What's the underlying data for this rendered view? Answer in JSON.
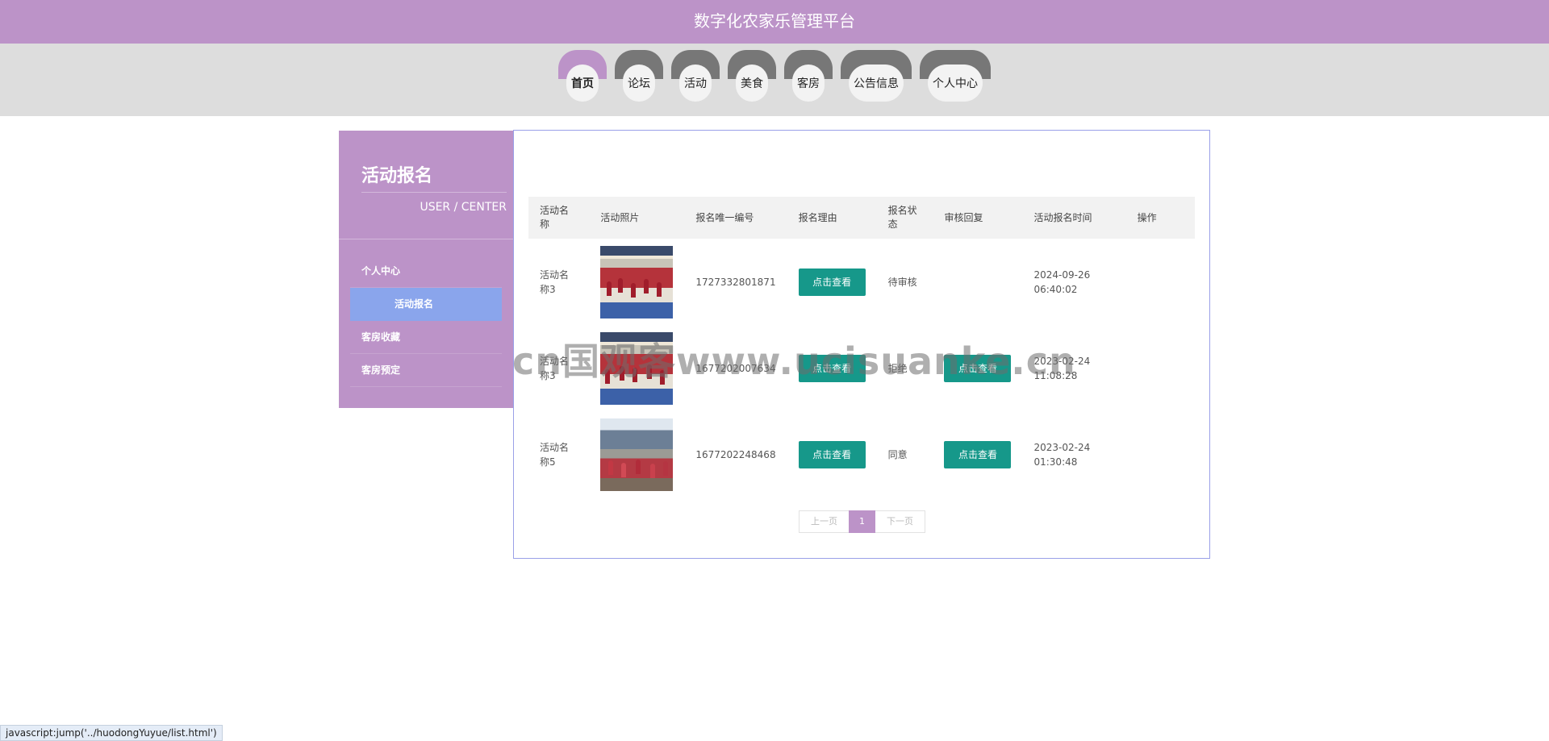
{
  "header": {
    "title": "数字化农家乐管理平台"
  },
  "nav": {
    "items": [
      {
        "label": "首页"
      },
      {
        "label": "论坛"
      },
      {
        "label": "活动"
      },
      {
        "label": "美食"
      },
      {
        "label": "客房"
      },
      {
        "label": "公告信息"
      },
      {
        "label": "个人中心"
      }
    ],
    "active": "首页"
  },
  "sidebar": {
    "title": "活动报名",
    "subtitle": "USER / CENTER",
    "menu": [
      {
        "label": "个人中心"
      },
      {
        "label": "活动报名"
      },
      {
        "label": "客房收藏"
      },
      {
        "label": "客房预定"
      }
    ],
    "active": "活动报名"
  },
  "table": {
    "headers": {
      "name": "活动名称",
      "photo": "活动照片",
      "id": "报名唯一编号",
      "reason": "报名理由",
      "status": "报名状态",
      "reply": "审核回复",
      "time": "活动报名时间",
      "op": "操作"
    },
    "view_label": "点击查看",
    "rows": [
      {
        "name": "活动名称3",
        "id": "1727332801871",
        "status": "待审核",
        "time": "2024-09-26 06:40:02"
      },
      {
        "name": "活动名称3",
        "id": "1677202007634",
        "status": "拒绝",
        "time": "2023-02-24 11:08:28"
      },
      {
        "name": "活动名称5",
        "id": "1677202248468",
        "status": "同意",
        "time": "2023-02-24 01:30:48"
      }
    ]
  },
  "pager": {
    "prev": "上一页",
    "current": "1",
    "next": "下一页"
  },
  "watermark": "cn国观客www.ucisuanke.cn",
  "status_bar": "javascript:jump('../huodongYuyue/list.html')",
  "colors": {
    "header": "#bc93c8",
    "sidebar_active": "#8aa5ec",
    "button": "#16988a",
    "panel_border": "#9aa0e8"
  }
}
